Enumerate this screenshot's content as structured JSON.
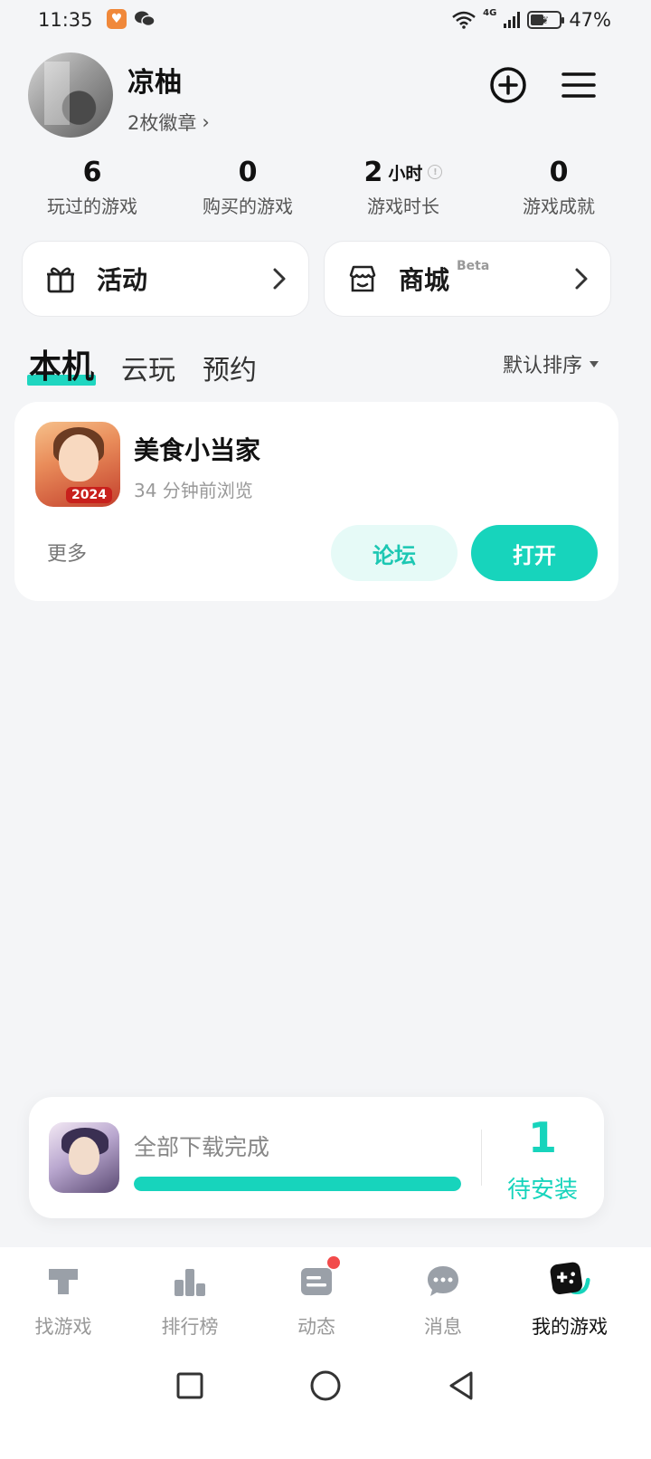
{
  "status_bar": {
    "time": "11:35",
    "network": "4G",
    "battery": "47%"
  },
  "profile": {
    "username": "凉柚",
    "badges": "2枚徽章",
    "badges_chevron": "›"
  },
  "stats": [
    {
      "value": "6",
      "unit": "",
      "label": "玩过的游戏"
    },
    {
      "value": "0",
      "unit": "",
      "label": "购买的游戏"
    },
    {
      "value": "2",
      "unit": "小时",
      "label": "游戏时长"
    },
    {
      "value": "0",
      "unit": "",
      "label": "游戏成就"
    }
  ],
  "shortcuts": {
    "activity": "活动",
    "store": "商城",
    "store_badge": "Beta"
  },
  "tabs": [
    {
      "label": "本机",
      "active": true
    },
    {
      "label": "云玩",
      "active": false
    },
    {
      "label": "预约",
      "active": false
    }
  ],
  "sort": {
    "label": "默认排序"
  },
  "game": {
    "title": "美食小当家",
    "icon_badge": "2024",
    "subtitle": "34 分钟前浏览",
    "more": "更多",
    "forum": "论坛",
    "open": "打开"
  },
  "download": {
    "status": "全部下载完成",
    "progress": 1.0,
    "count": "1",
    "count_label": "待安装"
  },
  "bottom_nav": [
    {
      "label": "找游戏",
      "icon": "find-games-icon",
      "active": false
    },
    {
      "label": "排行榜",
      "icon": "ranking-icon",
      "active": false
    },
    {
      "label": "动态",
      "icon": "feed-icon",
      "active": false,
      "dot": true
    },
    {
      "label": "消息",
      "icon": "message-icon",
      "active": false
    },
    {
      "label": "我的游戏",
      "icon": "my-games-icon",
      "active": true
    }
  ],
  "colors": {
    "accent": "#17d4bc",
    "accent_light": "#e6faf7",
    "background": "#f4f5f7",
    "notification": "#f24b4b"
  }
}
